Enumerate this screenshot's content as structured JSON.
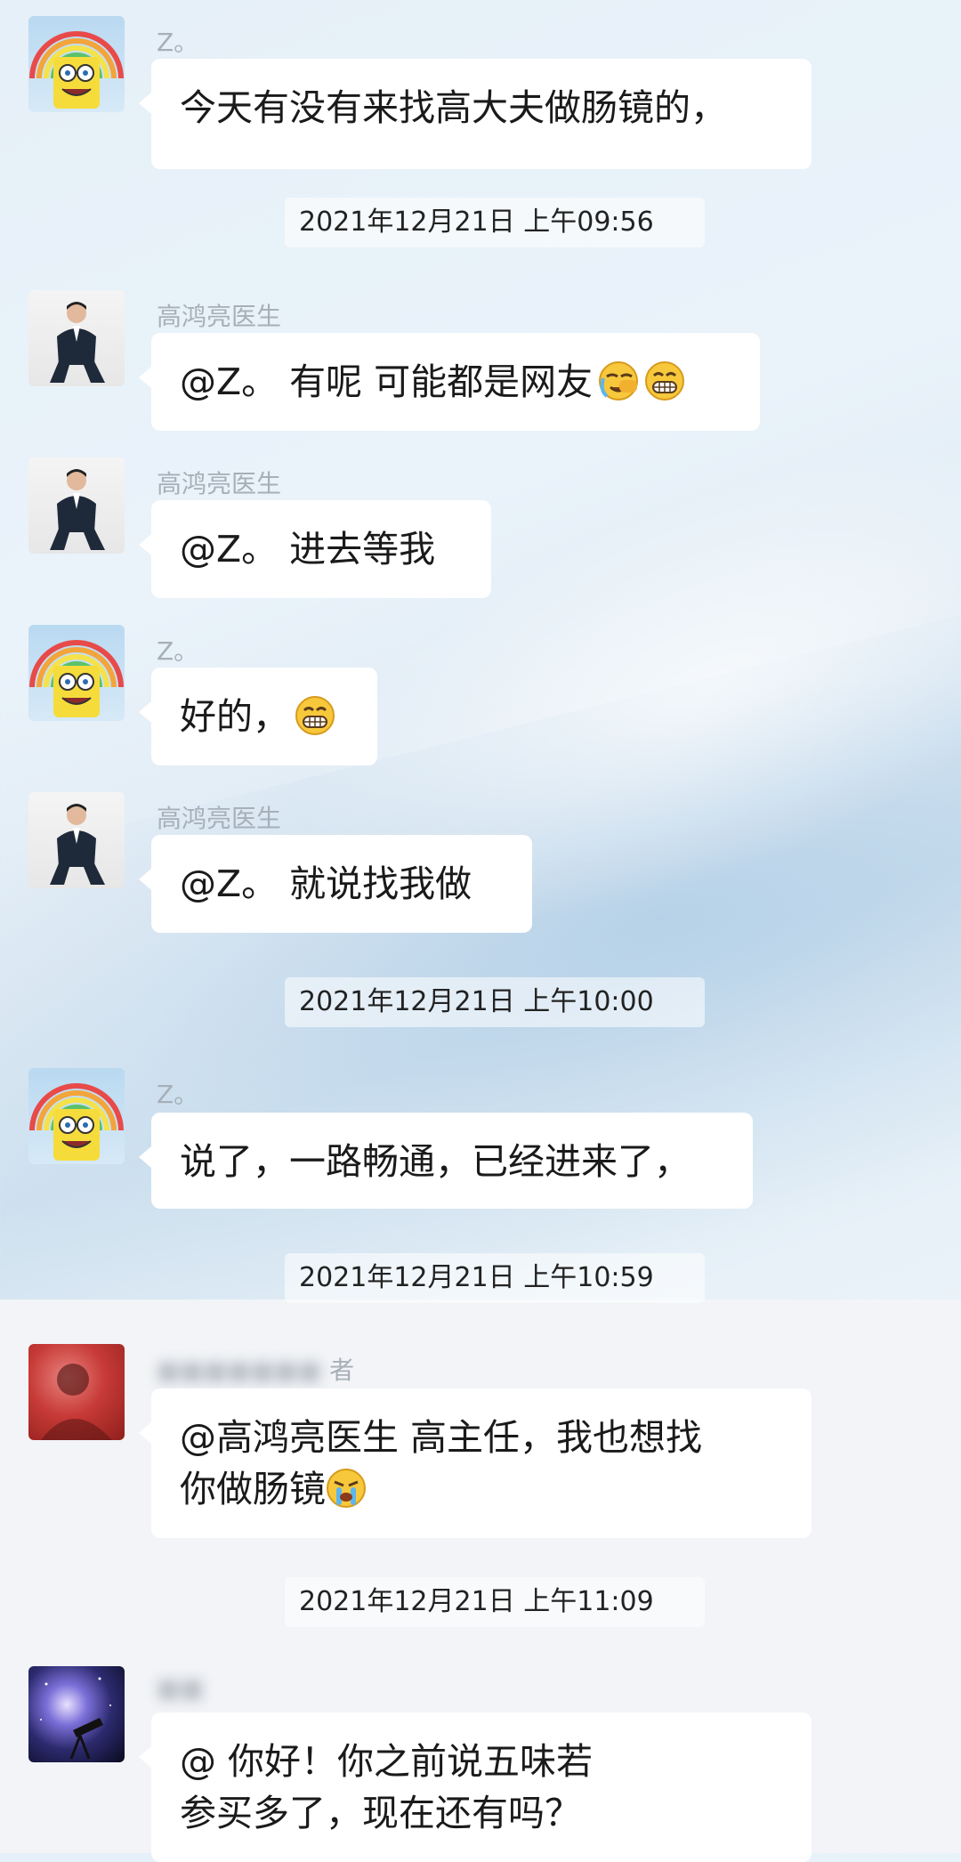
{
  "messages": [
    {
      "type": "msg",
      "sender": "Z。",
      "avatar": "spongebob-rainbow",
      "lines": [
        "今天有没有来找高大夫做肠镜的，"
      ]
    },
    {
      "type": "time",
      "text": "2021年12月21日 上午09:56"
    },
    {
      "type": "msg",
      "sender": "高鸿亮医生",
      "avatar": "doctor-suit",
      "lines": [
        "@Z。 有呢 可能都是网友"
      ],
      "emojis": [
        "facepalm-cry",
        "grin"
      ]
    },
    {
      "type": "msg",
      "sender": "高鸿亮医生",
      "avatar": "doctor-suit",
      "lines": [
        "@Z。 进去等我"
      ]
    },
    {
      "type": "msg",
      "sender": "Z。",
      "avatar": "spongebob-rainbow",
      "lines": [
        "好的，"
      ],
      "emojis": [
        "grin"
      ]
    },
    {
      "type": "msg",
      "sender": "高鸿亮医生",
      "avatar": "doctor-suit",
      "lines": [
        "@Z。 就说找我做"
      ]
    },
    {
      "type": "time",
      "text": "2021年12月21日 上午10:00"
    },
    {
      "type": "msg",
      "sender": "Z。",
      "avatar": "spongebob-rainbow",
      "lines": [
        "说了，一路畅通，已经进来了，"
      ]
    },
    {
      "type": "time",
      "text": "2021年12月21日 上午10:59"
    },
    {
      "type": "msg",
      "sender": "者",
      "avatar": "red-blurred",
      "lines": [
        "@高鸿亮医生  高主任，我也想找",
        "你做肠镜"
      ],
      "emojis": [
        "cry"
      ]
    },
    {
      "type": "time",
      "text": "2021年12月21日 上午11:09"
    },
    {
      "type": "msg",
      "sender": "",
      "avatar": "space-telescope",
      "lines": [
        "@  你好！你之前说五味若",
        "参买多了，现在还有吗？"
      ]
    }
  ],
  "colors": {
    "bubble": "#ffffff",
    "name": "#a7afb8",
    "text": "#1a1a1a"
  }
}
